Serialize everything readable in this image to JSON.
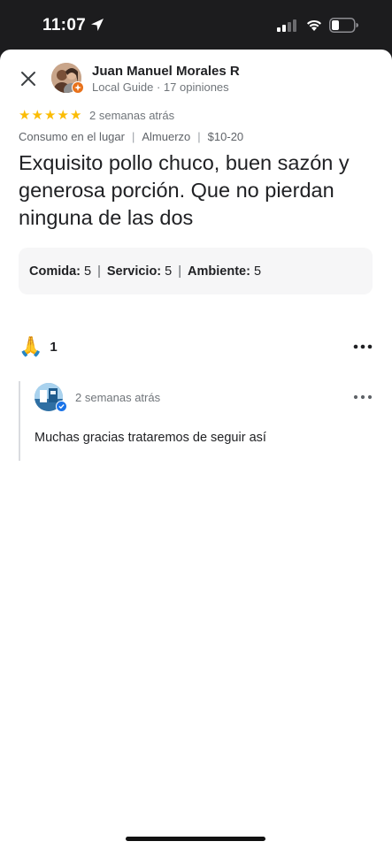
{
  "status_bar": {
    "time": "11:07"
  },
  "review": {
    "author_name": "Juan Manuel Morales R",
    "author_meta": "Local Guide · 17 opiniones",
    "rating": 5,
    "date": "2 semanas atrás",
    "attributes": [
      "Consumo en el lugar",
      "Almuerzo",
      "$10-20"
    ],
    "text": "Exquisito pollo chuco, buen sazón y generosa porción. Que no pierdan ninguna de las dos",
    "ratings": [
      {
        "label": "Comida:",
        "value": "5"
      },
      {
        "label": "Servicio:",
        "value": "5"
      },
      {
        "label": "Ambiente:",
        "value": "5"
      }
    ],
    "reaction_count": "1"
  },
  "owner_reply": {
    "date": "2 semanas atrás",
    "text": "Muchas gracias trataremos de seguir así"
  },
  "colors": {
    "star": "#fbbc04",
    "local_guide_badge": "#e8711a",
    "owner_badge": "#1a73e8"
  },
  "icons": [
    "location-arrow-icon",
    "signal-icon",
    "wifi-icon",
    "battery-icon",
    "close-icon",
    "local-guide-icon",
    "star-icon",
    "pray-icon",
    "more-icon",
    "verified-icon"
  ]
}
